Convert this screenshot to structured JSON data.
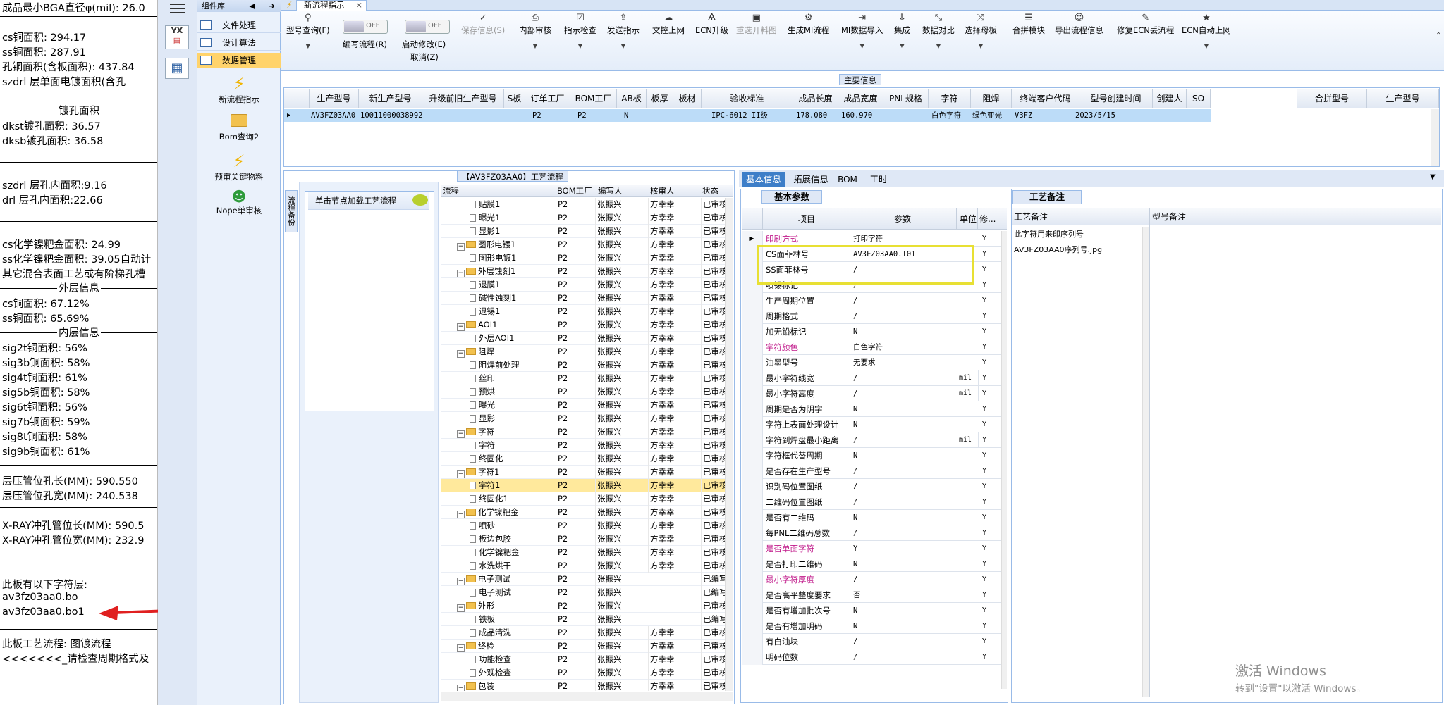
{
  "left_panel": {
    "lines": [
      "成品最小BGA直径φ(mil):  26.0",
      "cs铜面积: 294.17",
      "ss铜面积: 287.91",
      "孔铜面积(含板面积): 437.84",
      "szdrl       层单面电镀面积(含孔",
      "dkst镀孔面积: 36.57",
      "dksb镀孔面积: 36.58",
      "szdrl       层孔内面积:9.16",
      "drl         层孔内面积:22.66",
      "cs化学镍粑金面积: 24.99",
      "ss化学镍粑金面积: 39.05自动计",
      "其它混合表面工艺或有阶梯孔槽",
      "cs铜面积: 67.12%",
      "ss铜面积: 65.69%",
      "sig2t铜面积: 56%",
      "sig3b铜面积: 58%",
      "sig4t铜面积: 61%",
      "sig5b铜面积: 58%",
      "sig6t铜面积: 56%",
      "sig7b铜面积: 59%",
      "sig8t铜面积: 58%",
      "sig9b铜面积: 61%",
      "层压管位孔长(MM): 590.550",
      "层压管位孔宽(MM): 240.538",
      "X-RAY冲孔管位长(MM): 590.5",
      "X-RAY冲孔管位宽(MM): 232.9",
      "此板有以下字符层:",
      "av3fz03aa0.bo",
      "av3fz03aa0.bo1",
      "此板工艺流程: 图镀流程",
      "<<<<<<<_请检查周期格式及"
    ],
    "headings": [
      "镀孔面积",
      "外层信息",
      "内层信息"
    ]
  },
  "component_panel": {
    "title": "组件库",
    "items": [
      "文件处理",
      "设计算法",
      "数据管理"
    ],
    "tools": [
      "新流程指示",
      "Bom查询2",
      "预审关键物料",
      "Nope单审核"
    ]
  },
  "tab": {
    "title": "新流程指示",
    "close": "×"
  },
  "toolbar": {
    "buttons": [
      "型号查询(F)",
      "编写流程(R)",
      "启动修改(E)",
      "保存信息(S)",
      "内部审核",
      "指示检查",
      "发送指示",
      "文控上网",
      "ECN升级",
      "重选开料图",
      "生成MI流程",
      "MI数据导入",
      "集成",
      "数据对比",
      "选择母板",
      "合拼模块",
      "导出流程信息",
      "修复ECN丢流程",
      "ECN自动上网"
    ],
    "cancel": "取消(Z)",
    "toggle_off": "OFF"
  },
  "main_info": {
    "title": "主要信息",
    "headers": [
      "生产型号",
      "新生产型号",
      "升级前旧生产型号",
      "S板",
      "订单工厂",
      "BOM工厂",
      "AB板",
      "板厚",
      "板材",
      "验收标准",
      "成品长度",
      "成品宽度",
      "PNL规格",
      "字符",
      "阻焊",
      "终端客户代码",
      "型号创建时间",
      "创建人",
      "SO"
    ],
    "row": [
      "AV3FZ03AA0",
      "10011000038992",
      "",
      "",
      "P2",
      "P2",
      "N",
      "",
      "",
      "IPC-6012 II级",
      "178.080",
      "160.970",
      "",
      "白色字符",
      "绿色亚光",
      "V3FZ",
      "2023/5/15",
      "",
      ""
    ],
    "right_headers": [
      "合拼型号",
      "生产型号"
    ]
  },
  "process": {
    "title": "【AV3FZ03AA0】工艺流程",
    "side_tab": "流程备份",
    "hint": "单击节点加载工艺流程",
    "headers": [
      "流程",
      "BOM工厂",
      "编写人",
      "核审人",
      "状态"
    ],
    "rows": [
      {
        "name": "贴膜1",
        "level": 2,
        "bom": "P2",
        "author": "张振兴",
        "reviewer": "方幸幸",
        "status": "已审核"
      },
      {
        "name": "曝光1",
        "level": 2,
        "bom": "P2",
        "author": "张振兴",
        "reviewer": "方幸幸",
        "status": "已审核"
      },
      {
        "name": "显影1",
        "level": 2,
        "bom": "P2",
        "author": "张振兴",
        "reviewer": "方幸幸",
        "status": "已审核"
      },
      {
        "name": "图形电镀1",
        "level": 1,
        "bom": "P2",
        "author": "张振兴",
        "reviewer": "方幸幸",
        "status": "已审核"
      },
      {
        "name": "图形电镀1",
        "level": 2,
        "bom": "P2",
        "author": "张振兴",
        "reviewer": "方幸幸",
        "status": "已审核"
      },
      {
        "name": "外层蚀刻1",
        "level": 1,
        "bom": "P2",
        "author": "张振兴",
        "reviewer": "方幸幸",
        "status": "已审核"
      },
      {
        "name": "退膜1",
        "level": 2,
        "bom": "P2",
        "author": "张振兴",
        "reviewer": "方幸幸",
        "status": "已审核"
      },
      {
        "name": "碱性蚀刻1",
        "level": 2,
        "bom": "P2",
        "author": "张振兴",
        "reviewer": "方幸幸",
        "status": "已审核"
      },
      {
        "name": "退锡1",
        "level": 2,
        "bom": "P2",
        "author": "张振兴",
        "reviewer": "方幸幸",
        "status": "已审核"
      },
      {
        "name": "AOI1",
        "level": 1,
        "bom": "P2",
        "author": "张振兴",
        "reviewer": "方幸幸",
        "status": "已审核"
      },
      {
        "name": "外层AOI1",
        "level": 2,
        "bom": "P2",
        "author": "张振兴",
        "reviewer": "方幸幸",
        "status": "已审核"
      },
      {
        "name": "阻焊",
        "level": 1,
        "bom": "P2",
        "author": "张振兴",
        "reviewer": "方幸幸",
        "status": "已审核"
      },
      {
        "name": "阻焊前处理",
        "level": 2,
        "bom": "P2",
        "author": "张振兴",
        "reviewer": "方幸幸",
        "status": "已审核"
      },
      {
        "name": "丝印",
        "level": 2,
        "bom": "P2",
        "author": "张振兴",
        "reviewer": "方幸幸",
        "status": "已审核"
      },
      {
        "name": "预烘",
        "level": 2,
        "bom": "P2",
        "author": "张振兴",
        "reviewer": "方幸幸",
        "status": "已审核"
      },
      {
        "name": "曝光",
        "level": 2,
        "bom": "P2",
        "author": "张振兴",
        "reviewer": "方幸幸",
        "status": "已审核"
      },
      {
        "name": "显影",
        "level": 2,
        "bom": "P2",
        "author": "张振兴",
        "reviewer": "方幸幸",
        "status": "已审核"
      },
      {
        "name": "字符",
        "level": 1,
        "bom": "P2",
        "author": "张振兴",
        "reviewer": "方幸幸",
        "status": "已审核"
      },
      {
        "name": "字符",
        "level": 2,
        "bom": "P2",
        "author": "张振兴",
        "reviewer": "方幸幸",
        "status": "已审核"
      },
      {
        "name": "终固化",
        "level": 2,
        "bom": "P2",
        "author": "张振兴",
        "reviewer": "方幸幸",
        "status": "已审核"
      },
      {
        "name": "字符1",
        "level": 1,
        "bom": "P2",
        "author": "张振兴",
        "reviewer": "方幸幸",
        "status": "已审核"
      },
      {
        "name": "字符1",
        "level": 2,
        "bom": "P2",
        "author": "张振兴",
        "reviewer": "方幸幸",
        "status": "已审核",
        "highlight": true
      },
      {
        "name": "终固化1",
        "level": 2,
        "bom": "P2",
        "author": "张振兴",
        "reviewer": "方幸幸",
        "status": "已审核"
      },
      {
        "name": "化学镍粑金",
        "level": 1,
        "bom": "P2",
        "author": "张振兴",
        "reviewer": "方幸幸",
        "status": "已审核"
      },
      {
        "name": "喷砂",
        "level": 2,
        "bom": "P2",
        "author": "张振兴",
        "reviewer": "方幸幸",
        "status": "已审核"
      },
      {
        "name": "板边包胶",
        "level": 2,
        "bom": "P2",
        "author": "张振兴",
        "reviewer": "方幸幸",
        "status": "已审核"
      },
      {
        "name": "化学镍粑金",
        "level": 2,
        "bom": "P2",
        "author": "张振兴",
        "reviewer": "方幸幸",
        "status": "已审核"
      },
      {
        "name": "水洗烘干",
        "level": 2,
        "bom": "P2",
        "author": "张振兴",
        "reviewer": "方幸幸",
        "status": "已审核"
      },
      {
        "name": "电子测试",
        "level": 1,
        "bom": "P2",
        "author": "张振兴",
        "reviewer": "",
        "status": "已编写"
      },
      {
        "name": "电子测试",
        "level": 2,
        "bom": "P2",
        "author": "张振兴",
        "reviewer": "",
        "status": "已编写"
      },
      {
        "name": "外形",
        "level": 1,
        "bom": "P2",
        "author": "张振兴",
        "reviewer": "",
        "status": "已审核"
      },
      {
        "name": "铁板",
        "level": 2,
        "bom": "P2",
        "author": "张振兴",
        "reviewer": "",
        "status": "已编写"
      },
      {
        "name": "成品清洗",
        "level": 2,
        "bom": "P2",
        "author": "张振兴",
        "reviewer": "方幸幸",
        "status": "已审核"
      },
      {
        "name": "终检",
        "level": 1,
        "bom": "P2",
        "author": "张振兴",
        "reviewer": "方幸幸",
        "status": "已审核"
      },
      {
        "name": "功能检查",
        "level": 2,
        "bom": "P2",
        "author": "张振兴",
        "reviewer": "方幸幸",
        "status": "已审核"
      },
      {
        "name": "外观检查",
        "level": 2,
        "bom": "P2",
        "author": "张振兴",
        "reviewer": "方幸幸",
        "status": "已审核"
      },
      {
        "name": "包装",
        "level": 1,
        "bom": "P2",
        "author": "张振兴",
        "reviewer": "方幸幸",
        "status": "已审核"
      }
    ]
  },
  "detail_tabs": [
    "基本信息",
    "拓展信息",
    "BOM",
    "工时"
  ],
  "basic_params": {
    "title": "基本参数",
    "headers": [
      "项目",
      "参数",
      "单位",
      "修..."
    ],
    "rows": [
      {
        "item": "印刷方式",
        "value": "打印字符",
        "unit": "",
        "flag": "Y",
        "magenta": true
      },
      {
        "item": "CS面菲林号",
        "value": "AV3FZ03AA0.T01",
        "unit": "",
        "flag": "Y"
      },
      {
        "item": "SS面菲林号",
        "value": "/",
        "unit": "",
        "flag": "Y"
      },
      {
        "item": "喷锡标记",
        "value": "/",
        "unit": "",
        "flag": "Y"
      },
      {
        "item": "生产周期位置",
        "value": "/",
        "unit": "",
        "flag": "Y"
      },
      {
        "item": "周期格式",
        "value": "/",
        "unit": "",
        "flag": "Y"
      },
      {
        "item": "加无铅标记",
        "value": "N",
        "unit": "",
        "flag": "Y"
      },
      {
        "item": "字符颜色",
        "value": "白色字符",
        "unit": "",
        "flag": "Y",
        "magenta": true
      },
      {
        "item": "油墨型号",
        "value": "无要求",
        "unit": "",
        "flag": "Y"
      },
      {
        "item": "最小字符线宽",
        "value": "/",
        "unit": "mil",
        "flag": "Y"
      },
      {
        "item": "最小字符高度",
        "value": "/",
        "unit": "mil",
        "flag": "Y"
      },
      {
        "item": "周期是否为阴字",
        "value": "N",
        "unit": "",
        "flag": "Y"
      },
      {
        "item": "字符上表面处理设计",
        "value": "N",
        "unit": "",
        "flag": "Y"
      },
      {
        "item": "字符到焊盘最小距离",
        "value": "/",
        "unit": "mil",
        "flag": "Y"
      },
      {
        "item": "字符框代替周期",
        "value": "N",
        "unit": "",
        "flag": "Y"
      },
      {
        "item": "是否存在生产型号",
        "value": "/",
        "unit": "",
        "flag": "Y"
      },
      {
        "item": "识别码位置图纸",
        "value": "/",
        "unit": "",
        "flag": "Y"
      },
      {
        "item": "二维码位置图纸",
        "value": "/",
        "unit": "",
        "flag": "Y"
      },
      {
        "item": "是否有二维码",
        "value": "N",
        "unit": "",
        "flag": "Y"
      },
      {
        "item": "每PNL二维码总数",
        "value": "/",
        "unit": "",
        "flag": "Y"
      },
      {
        "item": "是否单面字符",
        "value": "Y",
        "unit": "",
        "flag": "Y",
        "magenta": true
      },
      {
        "item": "是否打印二维码",
        "value": "N",
        "unit": "",
        "flag": "Y"
      },
      {
        "item": "最小字符厚度",
        "value": "/",
        "unit": "",
        "flag": "Y",
        "magenta": true
      },
      {
        "item": "是否高平整度要求",
        "value": "否",
        "unit": "",
        "flag": "Y"
      },
      {
        "item": "是否有增加批次号",
        "value": "N",
        "unit": "",
        "flag": "Y"
      },
      {
        "item": "是否有增加明码",
        "value": "N",
        "unit": "",
        "flag": "Y"
      },
      {
        "item": "有白油块",
        "value": "/",
        "unit": "",
        "flag": "Y"
      },
      {
        "item": "明码位数",
        "value": "/",
        "unit": "",
        "flag": "Y"
      }
    ]
  },
  "process_notes": {
    "title": "工艺备注",
    "headers": [
      "工艺备注",
      "型号备注"
    ],
    "lines": [
      "此字符用来印序列号",
      "AV3FZ03AA0序列号.jpg"
    ]
  },
  "watermark": {
    "line1": "激活 Windows",
    "line2": "转到\"设置\"以激活 Windows。"
  },
  "colors": {
    "highlight_box": "#e8e033",
    "arrow": "#e02020",
    "selected_row": "#bcdcf8",
    "menu_selected": "#ffd36b",
    "magenta_label": "#c0198a"
  }
}
